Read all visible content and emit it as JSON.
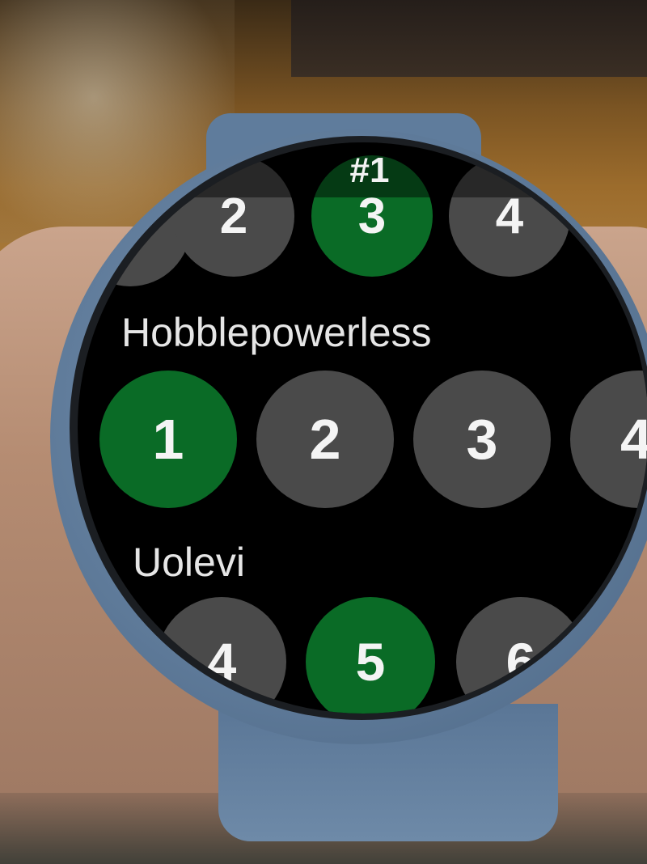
{
  "page_indicator": "#1",
  "colors": {
    "selected": "#0a6b26",
    "unselected": "#4a4a4a",
    "screen": "#000000",
    "text": "#e6e6e6"
  },
  "groups": [
    {
      "player_name": "",
      "ratings": [
        {
          "label": "2",
          "selected": false
        },
        {
          "label": "3",
          "selected": true
        },
        {
          "label": "4",
          "selected": false
        }
      ]
    },
    {
      "player_name": "Hobblepowerless",
      "ratings": [
        {
          "label": "1",
          "selected": true
        },
        {
          "label": "2",
          "selected": false
        },
        {
          "label": "3",
          "selected": false
        },
        {
          "label": "4",
          "selected": false
        }
      ]
    },
    {
      "player_name": "Uolevi",
      "ratings": [
        {
          "label": "4",
          "selected": false
        },
        {
          "label": "5",
          "selected": true
        },
        {
          "label": "6",
          "selected": false
        }
      ]
    }
  ]
}
